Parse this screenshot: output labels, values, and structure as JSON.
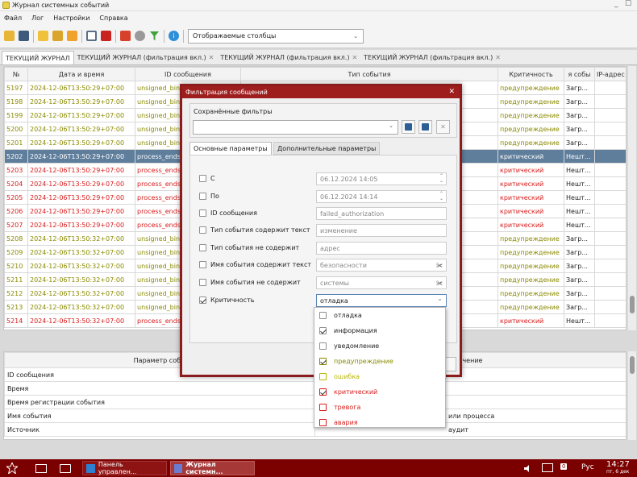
{
  "window": {
    "title": "Журнал системных событий",
    "minimize": "_",
    "maximize": "☐"
  },
  "menu": [
    "Файл",
    "Лог",
    "Настройки",
    "Справка"
  ],
  "toolbar": {
    "columns_combo": "Отображаемые столбцы"
  },
  "tabs": [
    {
      "label": "ТЕКУЩИЙ ЖУРНАЛ",
      "closable": false
    },
    {
      "label": "ТЕКУЩИЙ ЖУРНАЛ (фильтрация вкл.)",
      "closable": true
    },
    {
      "label": "ТЕКУЩИЙ ЖУРНАЛ (фильтрация вкл.)",
      "closable": true
    },
    {
      "label": "ТЕКУЩИЙ ЖУРНАЛ (фильтрация вкл.)",
      "closable": true
    }
  ],
  "grid": {
    "columns": [
      "№",
      "Дата и время",
      "ID сообщения",
      "Тип события",
      "Критичность",
      "я собы",
      "IP-адрес"
    ],
    "rows": [
      {
        "n": "5197",
        "dt": "2024-12-06T13:50:29+07:00",
        "id": "unsigned_bin",
        "crit": "предупреждение",
        "src": "Загр...",
        "level": "warn"
      },
      {
        "n": "5198",
        "dt": "2024-12-06T13:50:29+07:00",
        "id": "unsigned_bin",
        "crit": "предупреждение",
        "src": "Загр...",
        "level": "warn"
      },
      {
        "n": "5199",
        "dt": "2024-12-06T13:50:29+07:00",
        "id": "unsigned_bin",
        "crit": "предупреждение",
        "src": "Загр...",
        "level": "warn"
      },
      {
        "n": "5200",
        "dt": "2024-12-06T13:50:29+07:00",
        "id": "unsigned_bin",
        "crit": "предупреждение",
        "src": "Загр...",
        "level": "warn"
      },
      {
        "n": "5201",
        "dt": "2024-12-06T13:50:29+07:00",
        "id": "unsigned_bin",
        "crit": "предупреждение",
        "src": "Загр...",
        "level": "warn"
      },
      {
        "n": "5202",
        "dt": "2024-12-06T13:50:29+07:00",
        "id": "process_ends",
        "crit": "критический",
        "src": "Нешт...",
        "level": "sel"
      },
      {
        "n": "5203",
        "dt": "2024-12-06T13:50:29+07:00",
        "id": "process_ends",
        "crit": "критический",
        "src": "Нешт...",
        "level": "crit"
      },
      {
        "n": "5204",
        "dt": "2024-12-06T13:50:29+07:00",
        "id": "process_ends",
        "crit": "критический",
        "src": "Нешт...",
        "level": "crit"
      },
      {
        "n": "5205",
        "dt": "2024-12-06T13:50:29+07:00",
        "id": "process_ends",
        "crit": "критический",
        "src": "Нешт...",
        "level": "crit"
      },
      {
        "n": "5206",
        "dt": "2024-12-06T13:50:29+07:00",
        "id": "process_ends",
        "crit": "критический",
        "src": "Нешт...",
        "level": "crit"
      },
      {
        "n": "5207",
        "dt": "2024-12-06T13:50:29+07:00",
        "id": "process_ends",
        "crit": "критический",
        "src": "Нешт...",
        "level": "crit"
      },
      {
        "n": "5208",
        "dt": "2024-12-06T13:50:32+07:00",
        "id": "unsigned_bin",
        "crit": "предупреждение",
        "src": "Загр...",
        "level": "warn"
      },
      {
        "n": "5209",
        "dt": "2024-12-06T13:50:32+07:00",
        "id": "unsigned_bin",
        "crit": "предупреждение",
        "src": "Загр...",
        "level": "warn"
      },
      {
        "n": "5210",
        "dt": "2024-12-06T13:50:32+07:00",
        "id": "unsigned_bin",
        "crit": "предупреждение",
        "src": "Загр...",
        "level": "warn"
      },
      {
        "n": "5211",
        "dt": "2024-12-06T13:50:32+07:00",
        "id": "unsigned_bin",
        "crit": "предупреждение",
        "src": "Загр...",
        "level": "warn"
      },
      {
        "n": "5212",
        "dt": "2024-12-06T13:50:32+07:00",
        "id": "unsigned_bin",
        "crit": "предупреждение",
        "src": "Загр...",
        "level": "warn"
      },
      {
        "n": "5213",
        "dt": "2024-12-06T13:50:32+07:00",
        "id": "unsigned_bin",
        "crit": "предупреждение",
        "src": "Загр...",
        "level": "warn"
      },
      {
        "n": "5214",
        "dt": "2024-12-06T13:50:32+07:00",
        "id": "process_ends",
        "crit": "критический",
        "src": "Нешт...",
        "level": "crit"
      }
    ]
  },
  "details": {
    "header_param": "Параметр собы",
    "header_value": "ачение",
    "rows": [
      {
        "param": "ID сообщения",
        "value": ""
      },
      {
        "param": "Время",
        "value": ""
      },
      {
        "param": "Время регистрации события",
        "value": ""
      },
      {
        "param": "Имя события",
        "value": "или процесса"
      },
      {
        "param": "Источник",
        "value": "аудит"
      }
    ]
  },
  "dialog": {
    "title": "Фильтрация сообщений",
    "close": "✕",
    "saved_filters_label": "Сохранённые фильтры",
    "tab_main": "Основные параметры",
    "tab_extra": "Дополнительные параметры",
    "filters": [
      {
        "label": "С",
        "value": "06.12.2024 14:05",
        "checked": false,
        "kind": "spin"
      },
      {
        "label": "По",
        "value": "06.12.2024 14:14",
        "checked": false,
        "kind": "spin"
      },
      {
        "label": "ID сообщения",
        "value": "failed_authorization",
        "checked": false,
        "kind": "text"
      },
      {
        "label": "Тип события содержит текст",
        "value": "изменение",
        "checked": false,
        "kind": "text"
      },
      {
        "label": "Тип события не содержит",
        "value": "адрес",
        "checked": false,
        "kind": "text"
      },
      {
        "label": "Имя события содержит текст",
        "value": "безопасности",
        "checked": false,
        "kind": "broom"
      },
      {
        "label": "Имя события не содержит",
        "value": "системы",
        "checked": false,
        "kind": "broom"
      },
      {
        "label": "Критичность",
        "value": "отладка",
        "checked": true,
        "kind": "combo"
      }
    ]
  },
  "severity_dropdown": [
    {
      "label": "отладка",
      "checked": false,
      "color": "#222222"
    },
    {
      "label": "информация",
      "checked": true,
      "color": "#222222"
    },
    {
      "label": "уведомление",
      "checked": false,
      "color": "#222222"
    },
    {
      "label": "предупреждение",
      "checked": true,
      "color": "#8a8a00"
    },
    {
      "label": "ошибка",
      "checked": false,
      "color": "#b8b800"
    },
    {
      "label": "критический",
      "checked": true,
      "color": "#d81b1b"
    },
    {
      "label": "тревога",
      "checked": false,
      "color": "#d81b1b"
    },
    {
      "label": "авария",
      "checked": false,
      "color": "#d81b1b"
    }
  ],
  "taskbar": {
    "items": [
      "Панель управлен...",
      "Журнал системн..."
    ],
    "lang": "Рус",
    "time": "14:27",
    "date": "пт, 6 дек",
    "notif": "0"
  },
  "colors": {
    "accent": "#9e1d1d",
    "taskbar": "#7b0000",
    "selected_row": "#5f7e9c",
    "warning": "#8a8a00",
    "critical": "#d81b1b"
  }
}
